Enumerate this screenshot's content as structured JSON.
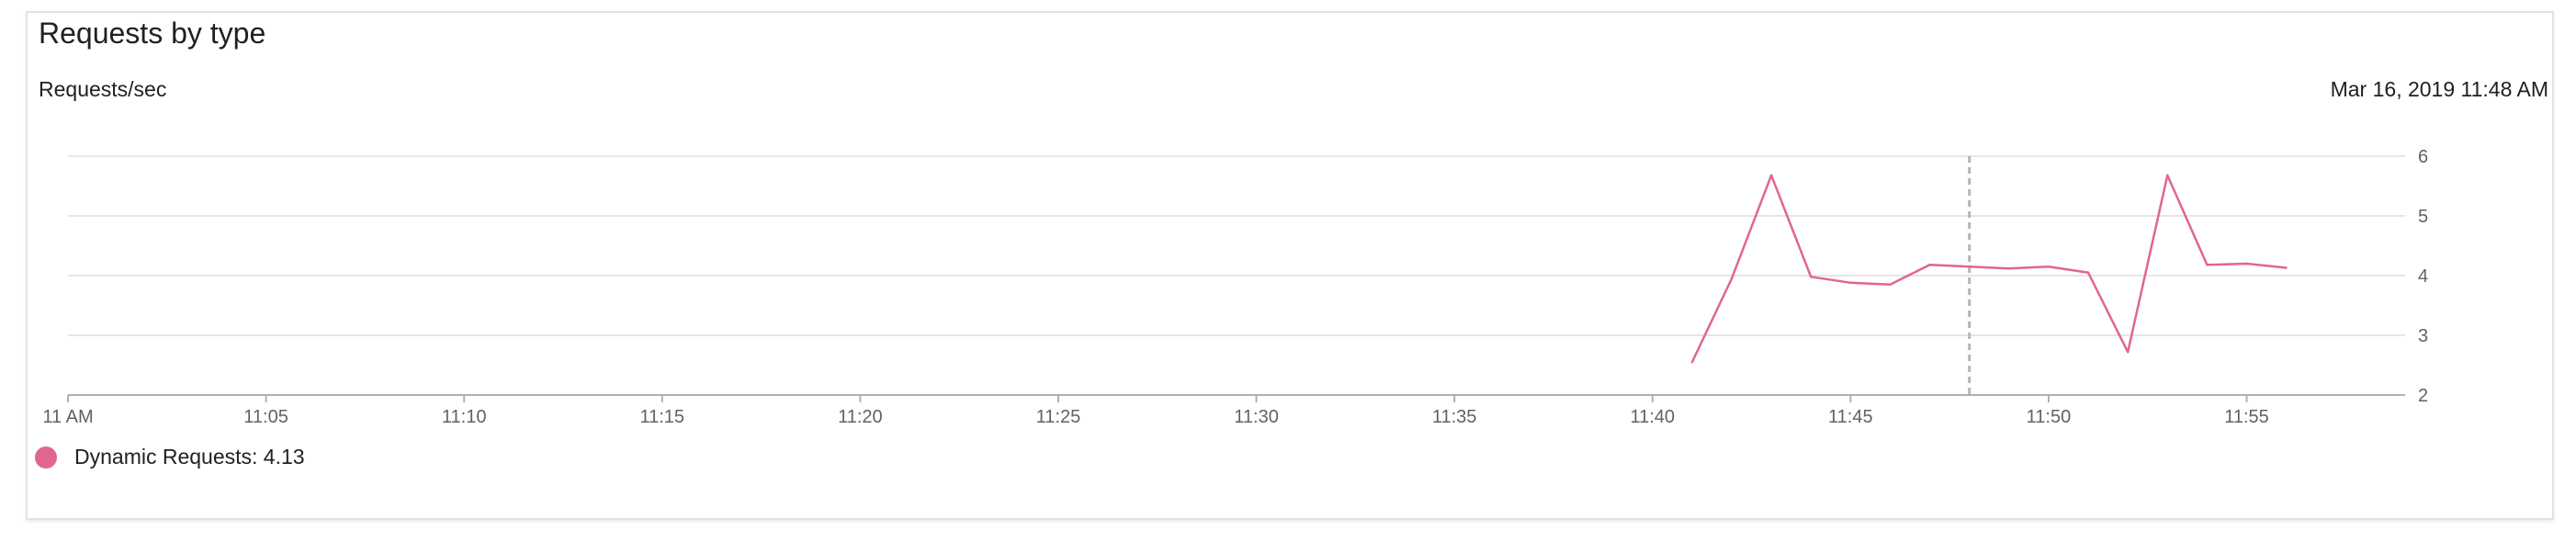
{
  "card": {
    "title": "Requests by type",
    "subtitle": "Requests/sec",
    "timestamp": "Mar 16, 2019 11:48 AM"
  },
  "legend": {
    "label": "Dynamic Requests: 4.13"
  },
  "colors": {
    "series": "#e0668f",
    "grid": "#e6e6e6",
    "axis": "#b0b0b0",
    "hover_line": "#b5b5b5",
    "tick_text": "#5f6368"
  },
  "chart_data": {
    "type": "line",
    "title": "Requests by type",
    "ylabel": "Requests/sec",
    "xlim": [
      "11:00",
      "11:59"
    ],
    "ylim": [
      2,
      6
    ],
    "y_ticks": [
      2,
      3,
      4,
      5,
      6
    ],
    "x_ticks": [
      {
        "t": "11:00",
        "label": "11 AM"
      },
      {
        "t": "11:05",
        "label": "11:05"
      },
      {
        "t": "11:10",
        "label": "11:10"
      },
      {
        "t": "11:15",
        "label": "11:15"
      },
      {
        "t": "11:20",
        "label": "11:20"
      },
      {
        "t": "11:25",
        "label": "11:25"
      },
      {
        "t": "11:30",
        "label": "11:30"
      },
      {
        "t": "11:35",
        "label": "11:35"
      },
      {
        "t": "11:40",
        "label": "11:40"
      },
      {
        "t": "11:45",
        "label": "11:45"
      },
      {
        "t": "11:50",
        "label": "11:50"
      },
      {
        "t": "11:55",
        "label": "11:55"
      }
    ],
    "grid": true,
    "legend_position": "bottom-left",
    "hover_time": "11:48",
    "series": [
      {
        "name": "Dynamic Requests",
        "x": [
          "11:41",
          "11:42",
          "11:43",
          "11:44",
          "11:45",
          "11:46",
          "11:47",
          "11:48",
          "11:49",
          "11:50",
          "11:51",
          "11:52",
          "11:53",
          "11:54",
          "11:55",
          "11:56"
        ],
        "values": [
          2.55,
          3.95,
          5.68,
          3.98,
          3.88,
          3.85,
          4.18,
          4.15,
          4.12,
          4.15,
          4.05,
          2.72,
          5.68,
          4.18,
          4.2,
          4.13
        ]
      }
    ]
  }
}
